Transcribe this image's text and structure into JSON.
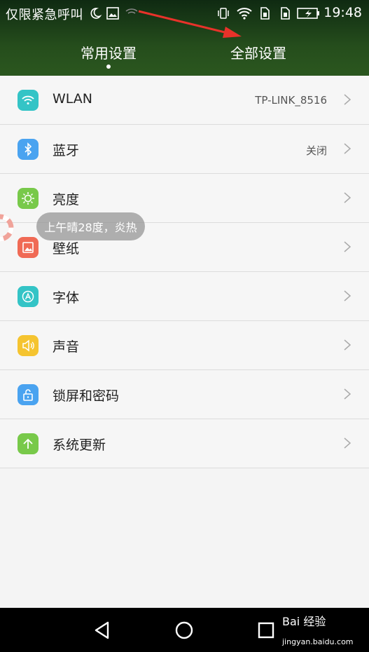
{
  "status_bar": {
    "carrier_text": "仅限紧急呼叫",
    "time": "19:48"
  },
  "tabs": [
    {
      "label": "常用设置",
      "active": true
    },
    {
      "label": "全部设置",
      "active": false
    }
  ],
  "settings": [
    {
      "label": "WLAN",
      "value": "TP-LINK_8516",
      "icon": "wifi-icon",
      "color": "#34c4c6"
    },
    {
      "label": "蓝牙",
      "value": "关闭",
      "icon": "bluetooth-icon",
      "color": "#4aa3f0"
    },
    {
      "label": "亮度",
      "value": "",
      "icon": "brightness-icon",
      "color": "#78c94a"
    },
    {
      "label": "壁纸",
      "value": "",
      "icon": "wallpaper-icon",
      "color": "#f06a55"
    },
    {
      "label": "字体",
      "value": "",
      "icon": "font-icon",
      "color": "#34c4c6"
    },
    {
      "label": "声音",
      "value": "",
      "icon": "sound-icon",
      "color": "#f5c430"
    },
    {
      "label": "锁屏和密码",
      "value": "",
      "icon": "lock-icon",
      "color": "#4aa3f0"
    },
    {
      "label": "系统更新",
      "value": "",
      "icon": "update-icon",
      "color": "#78c94a"
    }
  ],
  "weather_tooltip": "上午晴28度，炎热",
  "watermark": {
    "title": "Bai 经验",
    "url": "jingyan.baidu.com"
  }
}
